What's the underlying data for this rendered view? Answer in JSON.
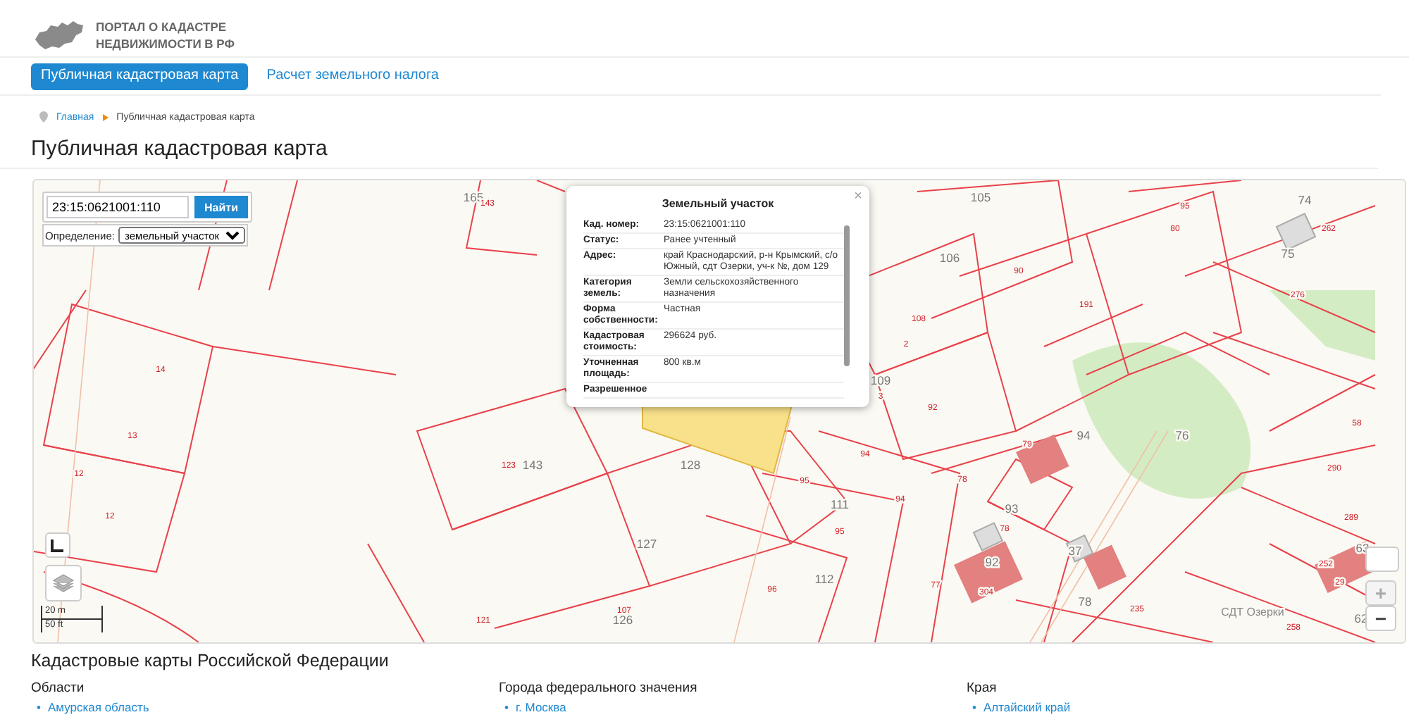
{
  "header": {
    "logo_text_1": "ПОРТАЛ О КАДАСТРЕ",
    "logo_text_2": "НЕДВИЖИМОСТИ В РФ"
  },
  "tabs": [
    {
      "label": "Публичная кадастровая карта",
      "selected": true
    },
    {
      "label": "Расчет земельного налога",
      "selected": false
    }
  ],
  "breadcrumb": [
    {
      "label": "Главная"
    },
    {
      "label": "Публичная кадастровая карта"
    }
  ],
  "page_title": "Публичная кадастровая карта",
  "map": {
    "search": {
      "value": "23:15:0621001:110",
      "button": "Найти"
    },
    "definition": {
      "label": "Определение:",
      "value": "земельный участок"
    },
    "scale": {
      "metric": "20 m",
      "imperial": "50 ft"
    },
    "zoom_in": "+",
    "zoom_out": "−",
    "labels": [
      "165",
      "143",
      "105",
      "95",
      "74",
      "106",
      "80",
      "262",
      "75",
      "90",
      "191",
      "276",
      "108",
      "2",
      "109",
      "3",
      "14",
      "92",
      "94",
      "76",
      "58",
      "13",
      "123",
      "143",
      "128",
      "94",
      "79",
      "290",
      "12",
      "95",
      "111",
      "94",
      "78",
      "93",
      "289",
      "12",
      "95",
      "78",
      "127",
      "37",
      "63",
      "92",
      "112",
      "77",
      "304",
      "96",
      "235",
      "121",
      "107",
      "126",
      "78",
      "62",
      "СДТ Озерки",
      "258",
      "252",
      "29"
    ],
    "popup": {
      "title": "Земельный участок",
      "close": "×",
      "rows": [
        {
          "label": "Кад. номер:",
          "value": "23:15:0621001:110"
        },
        {
          "label": "Статус:",
          "value": "Ранее учтенный"
        },
        {
          "label": "Адрес:",
          "value": "край Краснодарский, р-н Крымский, с/о Южный, сдт Озерки, уч-к №, дом 129"
        },
        {
          "label": "Категория земель:",
          "value": "Земли сельскохозяйственного назначения"
        },
        {
          "label": "Форма собственности:",
          "value": "Частная"
        },
        {
          "label": "Кадастровая стоимость:",
          "value": "296624 руб."
        },
        {
          "label": "Уточненная площадь:",
          "value": "800 кв.м"
        },
        {
          "label": "Разрешенное"
        }
      ]
    }
  },
  "catalog": {
    "bullet": "•",
    "title": "Кадастровые карты Российской Федерации",
    "columns": [
      {
        "heading": "Области",
        "links": [
          "Амурская область"
        ]
      },
      {
        "heading": "Города федерального значения",
        "links": [
          "г. Москва"
        ]
      },
      {
        "heading": "Края",
        "links": [
          "Алтайский край"
        ]
      }
    ]
  }
}
